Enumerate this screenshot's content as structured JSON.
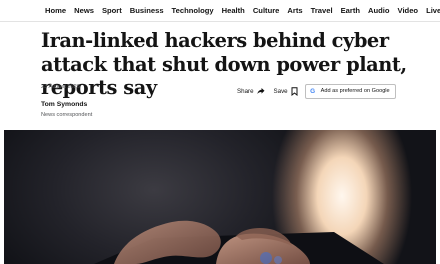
{
  "nav": {
    "items": [
      "Home",
      "News",
      "Sport",
      "Business",
      "Technology",
      "Health",
      "Culture",
      "Arts",
      "Travel",
      "Earth",
      "Audio",
      "Video",
      "Live"
    ]
  },
  "article": {
    "headline": "Iran-linked hackers behind cyber attack that shut down power plant, reports say",
    "date": "23 August 2026",
    "author": "Tom Symonds",
    "author_role": "News correspondent"
  },
  "actions": {
    "share_label": "Share",
    "save_label": "Save",
    "preferred_label": "Add as preferred on Google"
  },
  "icons": {
    "share": "share-icon",
    "save": "bookmark-icon",
    "google": "google-logo-icon"
  },
  "colors": {
    "text": "#141414",
    "muted": "#545658",
    "google_blue": "#4285f4"
  }
}
